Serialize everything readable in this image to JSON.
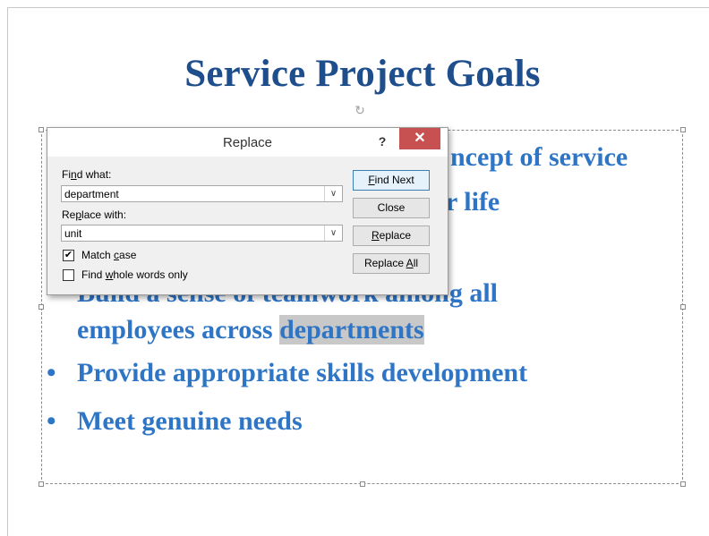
{
  "slide": {
    "title": "Service Project Goals",
    "bullets": [
      {
        "bullet": "",
        "pre": "",
        "hidden_text": "Instill the concept of service",
        "visible_text": "ncept of service"
      },
      {
        "bullet": "",
        "pre": "",
        "hidden_text": "as a way of life",
        "visible_text": "r life"
      },
      {
        "bullet": "",
        "text_part1": "Build a sense of teamwork ",
        "text_part2": "among all"
      },
      {
        "bullet": "",
        "line2_pre": "employees across ",
        "highlight": "departments"
      },
      {
        "bullet": "•",
        "text": "Provide appropriate skills development"
      },
      {
        "bullet": "•",
        "text": "Meet genuine needs"
      }
    ]
  },
  "dialog": {
    "title": "Replace",
    "help": "?",
    "close": "✕",
    "find_label_pre": "Fi",
    "find_label_u": "n",
    "find_label_post": "d what:",
    "find_value": "department",
    "replace_label_pre": "Re",
    "replace_label_u": "p",
    "replace_label_post": "lace with:",
    "replace_value": "unit",
    "match_case_pre": "Match ",
    "match_case_u": "c",
    "match_case_post": "ase",
    "match_case_checked": true,
    "whole_words_pre": "Find ",
    "whole_words_u": "w",
    "whole_words_post": "hole words only",
    "whole_words_checked": false,
    "buttons": {
      "find_next_u": "F",
      "find_next_rest": "ind Next",
      "close": "Close",
      "replace_u": "R",
      "replace_rest": "eplace",
      "replace_all_pre": "Replace ",
      "replace_all_u": "A",
      "replace_all_post": "ll"
    },
    "dropdown_icon": "chevron-down-icon",
    "check_mark": "✔"
  }
}
